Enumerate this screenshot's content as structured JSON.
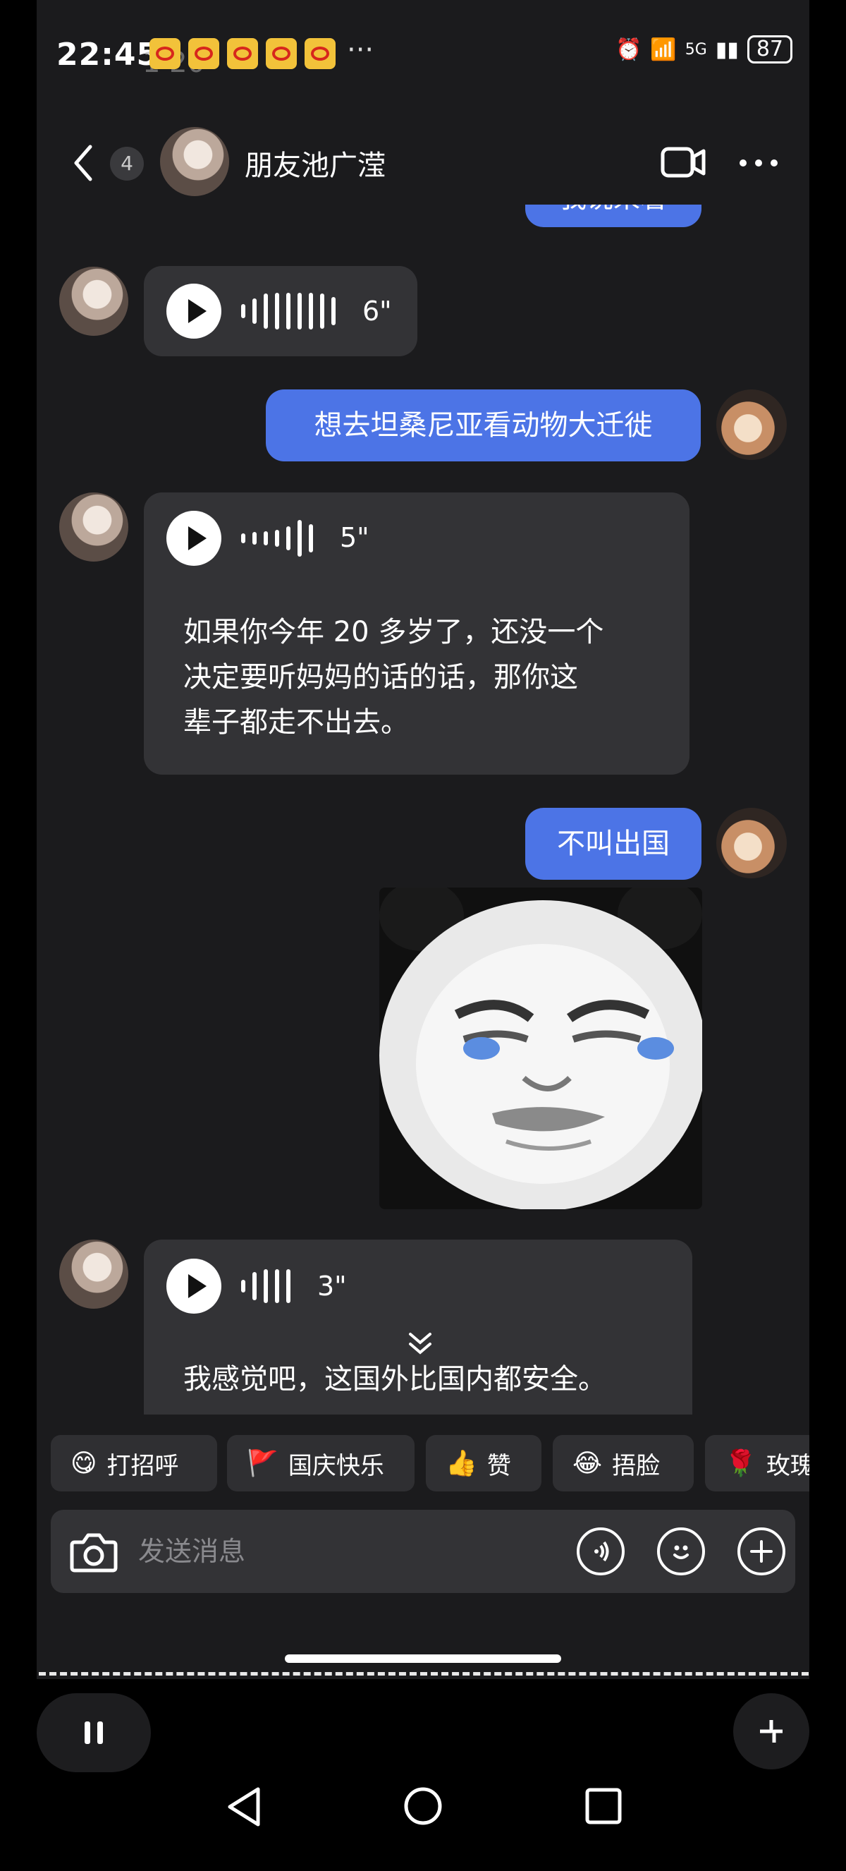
{
  "status_bar": {
    "time": "22:45",
    "overlay_num": "1  20",
    "more": "···",
    "signal": "5G",
    "battery": "87"
  },
  "header": {
    "back_icon": "back-arrow-icon",
    "badge": "4",
    "name": "朋友池广滢",
    "video_icon": "video-camera-icon",
    "more_icon": "more-dots-icon"
  },
  "messages": {
    "top_partial": "我说来着",
    "voice1_duration": "6\"",
    "sent1": "想去坦桑尼亚看动物大迁徙",
    "voice2_duration": "5\"",
    "voice2_transcript_line1": "如果你今年 20 多岁了，还没一个",
    "voice2_transcript_line2": "决定要听妈妈的话的话，那你这",
    "voice2_transcript_line3": "辈子都走不出去。",
    "sent2": "不叫出国",
    "voice3_duration": "3\"",
    "voice3_transcript": "我感觉吧，这国外比国内都安全。"
  },
  "quick_replies": [
    {
      "icon": "smile-emoji-icon",
      "label": "打招呼"
    },
    {
      "icon": "red-flag-icon",
      "label": "国庆快乐"
    },
    {
      "icon": "thumbs-up-icon",
      "label": "赞"
    },
    {
      "icon": "facepalm-emoji-icon",
      "label": "捂脸"
    },
    {
      "icon": "rose-icon",
      "label": "玫瑰"
    }
  ],
  "input": {
    "placeholder": "发送消息"
  },
  "colors": {
    "bubble_sent": "#4c74e6",
    "bubble_received": "#333336",
    "background": "#1b1b1d"
  }
}
